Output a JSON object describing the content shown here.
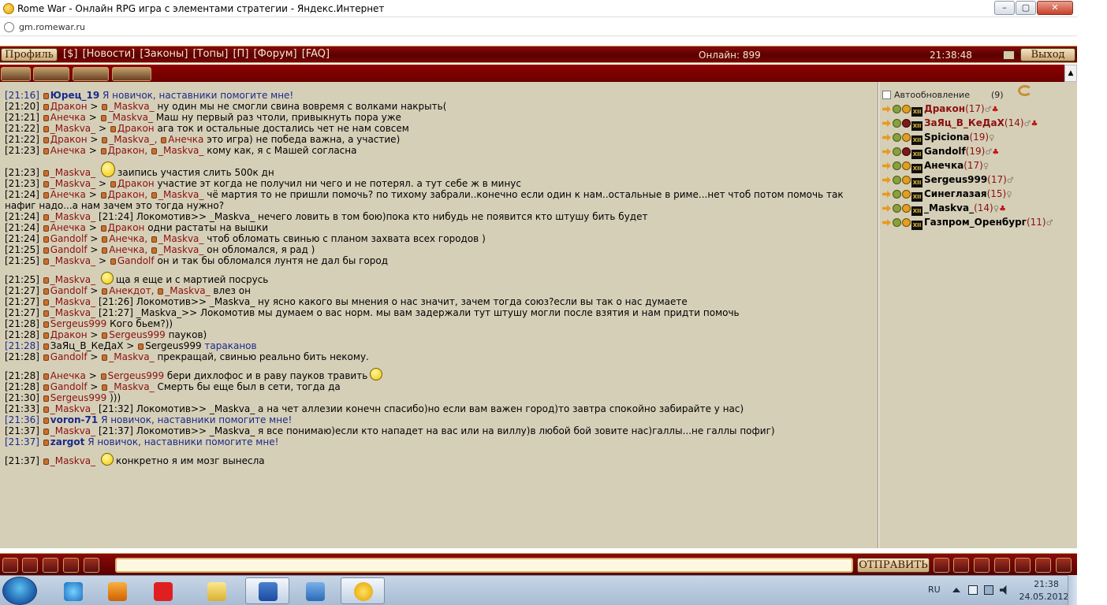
{
  "window": {
    "title": "Rome War - Онлайн RPG игра с элементами стратегии - Яндекс.Интернет"
  },
  "address": {
    "url": "gm.romewar.ru"
  },
  "topmenu": {
    "profile": "Профиль",
    "links": [
      "[$]",
      "[Новости]",
      "[Законы]",
      "[Топы]",
      "[П]",
      "[Форум]",
      "[FAQ]"
    ],
    "online": "Онлайн: 899",
    "clock": "21:38:48",
    "exit": "Выход"
  },
  "chat": {
    "messages": [
      {
        "time": "[21:16]",
        "type": "sys",
        "from": "Юрец_19",
        "text": "Я новичок, наставники помогите мне!"
      },
      {
        "time": "[21:20]",
        "from": "Дракон",
        "to": [
          "_Maskva_"
        ],
        "text": "ну один мы не смогли свина вовремя с волками накрыть("
      },
      {
        "time": "[21:21]",
        "from": "Анечка",
        "to": [
          "_Maskva_"
        ],
        "text": "Маш ну первый раз чтоли, привыкнуть пора уже"
      },
      {
        "time": "[21:22]",
        "from": "_Maskva_",
        "to": [
          "Дракон"
        ],
        "text": "ага ток и остальные достались чет не нам совсем"
      },
      {
        "time": "[21:22]",
        "from": "Дракон",
        "to": [
          "_Maskva_,",
          "Анечка"
        ],
        "text": "это игра) не победа важна, а участие)"
      },
      {
        "time": "[21:23]",
        "from": "Анечка",
        "to": [
          "Дракон,",
          "_Maskva_"
        ],
        "text": "кому как, я с Машей согласна"
      },
      {
        "time": "[21:23]",
        "from": "_Maskva_",
        "to": [],
        "smile": "big",
        "text": "заипись участия слить 500к дн"
      },
      {
        "time": "[21:23]",
        "from": "_Maskva_",
        "to": [
          "Дракон"
        ],
        "text": "участие эт когда не получил ни чего и не потерял. а тут себе ж в минус"
      },
      {
        "time": "[21:24]",
        "from": "Анечка",
        "to": [
          "Дракон,",
          "_Maskva_"
        ],
        "text": "чё мартия то не пришли помочь? по тихому забрали..конечно если один к  нам..остальные в риме...нет чтоб потом помочь так нафиг надо...а нам зачем это  тогда нужно?"
      },
      {
        "time": "[21:24]",
        "from": "_Maskva_",
        "to": [],
        "text": "[21:24] Локомотив>> _Maskva_ нечего ловить в том бою)пока кто нибудь не  появится кто штушу бить будет"
      },
      {
        "time": "[21:24]",
        "from": "Анечка",
        "to": [
          "Дракон"
        ],
        "text": "одни растаты на вышки"
      },
      {
        "time": "[21:24]",
        "from": "Gandolf",
        "to": [
          "Анечка,",
          "_Maskva_"
        ],
        "text": "чтоб обломать свинью с планом захвата всех городов )"
      },
      {
        "time": "[21:25]",
        "from": "Gandolf",
        "to": [
          "Анечка,",
          "_Maskva_"
        ],
        "text": "он обломался, я рад )"
      },
      {
        "time": "[21:25]",
        "from": "_Maskva_",
        "to": [
          "Gandolf"
        ],
        "text": "он и так бы обломался лунтя не дал бы город"
      },
      {
        "time": "[21:25]",
        "from": "_Maskva_",
        "to": [],
        "smile": "normal",
        "text": "ща я еще и с мартией посрусь"
      },
      {
        "time": "[21:27]",
        "from": "Gandolf",
        "to": [
          "Анекдот,",
          "_Maskva_"
        ],
        "text": "влез он"
      },
      {
        "time": "[21:27]",
        "from": "_Maskva_",
        "to": [],
        "text": "[21:26] Локомотив>> _Maskva_ ну ясно какого вы мнения о нас значит,  зачем тогда союз?если вы так о нас думаете"
      },
      {
        "time": "[21:27]",
        "from": "_Maskva_",
        "to": [],
        "text": "[21:27] _Maskva_>> Локомотив мы думаем о вас норм. мы вам задержали тут  штушу могли после взятия и нам придти помочь"
      },
      {
        "time": "[21:28]",
        "from": "Sergeus999",
        "to": [],
        "text": "Кого бьем?))"
      },
      {
        "time": "[21:28]",
        "from": "Дракон",
        "to": [
          "Sergeus999"
        ],
        "text": "пауков)"
      },
      {
        "time": "[21:28]",
        "type": "blue",
        "from": "ЗаЯц_В_КеДаХ",
        "to": [
          "Sergeus999"
        ],
        "text": "тараканов"
      },
      {
        "time": "[21:28]",
        "from": "Gandolf",
        "to": [
          "_Maskva_"
        ],
        "text": "прекращай, свинью реально бить некому."
      },
      {
        "time": "[21:28]",
        "from": "Анечка",
        "to": [
          "Sergeus999"
        ],
        "text": "бери дихлофос и в раву пауков травить",
        "smile_after": true
      },
      {
        "time": "[21:28]",
        "from": "Gandolf",
        "to": [
          "_Maskva_"
        ],
        "text": "Смерть бы еще был в сети, тогда да"
      },
      {
        "time": "[21:30]",
        "from": "Sergeus999",
        "to": [],
        "text": ")))"
      },
      {
        "time": "[21:33]",
        "from": "_Maskva_",
        "to": [],
        "text": "[21:32] Локомотив>> _Maskva_ а на чет аллезии конечн спасибо)но если  вам важен город)то завтра спокойно забирайте у нас)"
      },
      {
        "time": "[21:36]",
        "type": "sys",
        "from": "voron-71",
        "text": "Я новичок, наставники помогите мне!"
      },
      {
        "time": "[21:37]",
        "from": "_Maskva_",
        "to": [],
        "text": "[21:37] Локомотив>> _Maskva_ я все понимаю)если кто нападет на вас или  на виллу)в любой бой зовите нас)галлы...не галлы пофиг)"
      },
      {
        "time": "[21:37]",
        "type": "sys",
        "from": "zargot",
        "text": "Я новичок, наставники помогите мне!"
      },
      {
        "time": "[21:37]",
        "from": "_Maskva_",
        "to": [],
        "smile": "normal",
        "text": "конкретно я им мозг вынесла"
      }
    ]
  },
  "userlist": {
    "autoupdate_label": "Автообновление",
    "count": "(9)",
    "users": [
      {
        "name": "Дракон",
        "level": "(17)",
        "red": true,
        "dark": false,
        "sym": "♂",
        "rsym": "♣"
      },
      {
        "name": "ЗаЯц_В_КеДаХ",
        "level": "(14)",
        "red": true,
        "dark": true,
        "sym": "♂",
        "rsym": "♣"
      },
      {
        "name": "Spiciona",
        "level": "(19)",
        "red": false,
        "dark": false,
        "sym": "♀",
        "rsym": ""
      },
      {
        "name": "Gandolf",
        "level": "(19)",
        "red": false,
        "dark": true,
        "sym": "♂",
        "rsym": "♣"
      },
      {
        "name": "Анечка",
        "level": "(17)",
        "red": false,
        "dark": false,
        "sym": "♀",
        "rsym": ""
      },
      {
        "name": "Sergeus999",
        "level": "(17)",
        "red": false,
        "dark": false,
        "sym": "♂",
        "rsym": ""
      },
      {
        "name": "Синеглазая",
        "level": "(15)",
        "red": false,
        "dark": false,
        "sym": "♀",
        "rsym": ""
      },
      {
        "name": "_Maskva_",
        "level": "(14)",
        "red": false,
        "dark": false,
        "sym": "♀",
        "rsym": "♣"
      },
      {
        "name": "Газпром_Оренбург",
        "level": "(11)",
        "red": false,
        "dark": false,
        "sym": "♂",
        "rsym": ""
      }
    ]
  },
  "bottombar": {
    "send": "ОТПРАВИТЬ",
    "input_value": ""
  },
  "taskbar": {
    "lang": "RU",
    "time": "21:38",
    "date": "24.05.2012"
  },
  "colors": {
    "menu_red": "#7a0505",
    "chat_bg": "#d6cfb8",
    "nick": "#8a1010",
    "system": "#1a2a8a"
  }
}
